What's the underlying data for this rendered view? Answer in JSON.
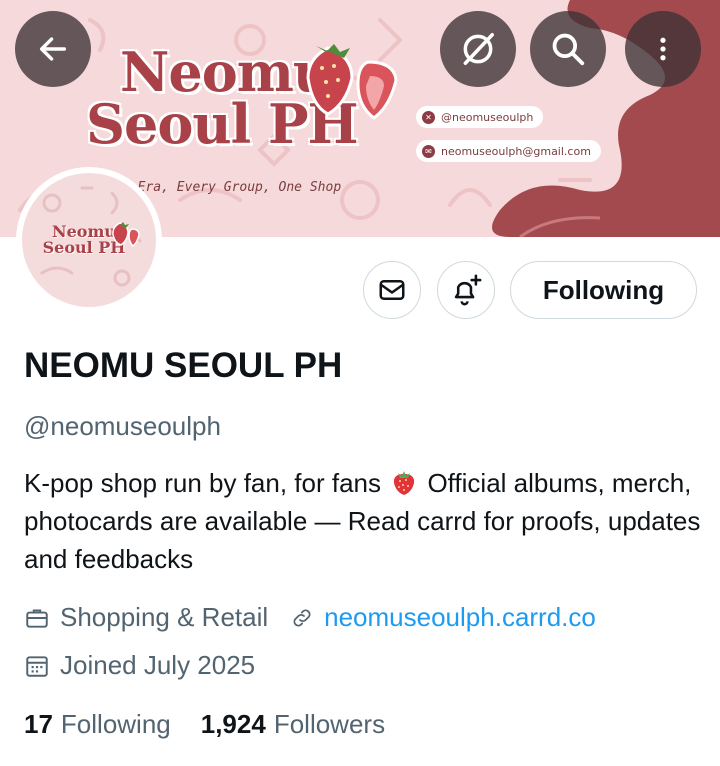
{
  "banner": {
    "brand_line1": "Neomu",
    "brand_line2": "Seoul PH",
    "tagline": "· Era, Every Group, One Shop",
    "contact_x": "@neomuseoulph",
    "contact_email": "neomuseoulph@gmail.com",
    "colors": {
      "background": "#f6d9da",
      "accent": "#a94148",
      "wave": "#a34a4f"
    }
  },
  "avatar": {
    "line1": "Neomu",
    "line2": "Seoul PH"
  },
  "nav": {
    "back_icon": "arrow-left-icon",
    "grok_icon": "grok-icon",
    "search_icon": "search-icon",
    "more_icon": "more-vertical-icon"
  },
  "actions": {
    "message_icon": "envelope-icon",
    "notify_icon": "bell-plus-icon",
    "following_label": "Following"
  },
  "profile": {
    "display_name": "NEOMU SEOUL PH",
    "handle": "@neomuseoulph",
    "bio_part1": "K-pop shop run by fan, for fans",
    "bio_part2": " Official albums, merch, photocards are available — Read carrd for proofs, updates and feedbacks",
    "category": "Shopping & Retail",
    "website": "neomuseoulph.carrd.co",
    "joined": "Joined July 2025"
  },
  "stats": {
    "following_count": "17",
    "following_label": "Following",
    "followers_count": "1,924",
    "followers_label": "Followers"
  },
  "colors": {
    "link": "#1d9bf0",
    "muted": "#536471",
    "text": "#0f1419",
    "border": "#cfd9de"
  }
}
